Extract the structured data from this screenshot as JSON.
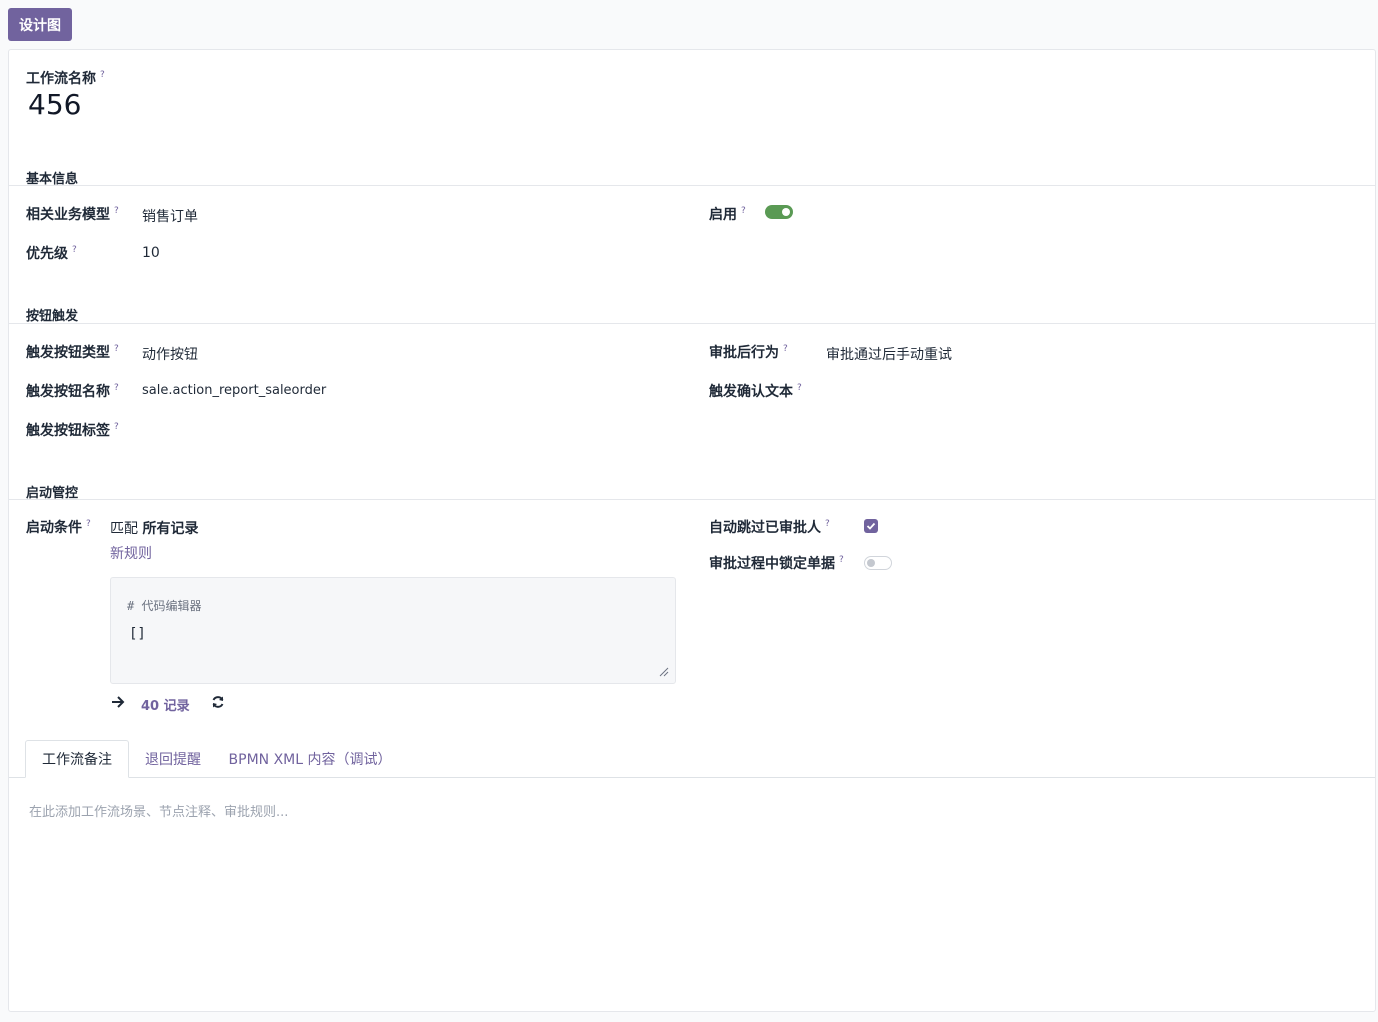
{
  "toolbar": {
    "design_label": "设计图"
  },
  "name_field": {
    "label": "工作流名称",
    "value": "456"
  },
  "help_mark": "?",
  "sections": {
    "basic": {
      "title": "基本信息",
      "model_label": "相关业务模型",
      "model_value": "销售订单",
      "priority_label": "优先级",
      "priority_value": "10",
      "enabled_label": "启用",
      "enabled": true
    },
    "button_trigger": {
      "title": "按钮触发",
      "btn_type_label": "触发按钮类型",
      "btn_type_value": "动作按钮",
      "btn_name_label": "触发按钮名称",
      "btn_name_value": "sale.action_report_saleorder",
      "btn_tag_label": "触发按钮标签",
      "btn_tag_value": "",
      "after_label": "审批后行为",
      "after_value": "审批通过后手动重试",
      "confirm_label": "触发确认文本",
      "confirm_value": ""
    },
    "start_control": {
      "title": "启动管控",
      "condition_label": "启动条件",
      "match_prefix": "匹配",
      "match_value": "所有记录",
      "new_rule": "新规则",
      "code_comment": "# 代码编辑器",
      "code_value": "[]",
      "records_count": "40 记录",
      "skip_label": "自动跳过已审批人",
      "skip_checked": true,
      "lock_label": "审批过程中锁定单据",
      "lock_enabled": false
    }
  },
  "tabs": [
    {
      "label": "工作流备注",
      "active": true
    },
    {
      "label": "退回提醒",
      "active": false
    },
    {
      "label": "BPMN XML 内容（调试）",
      "active": false
    }
  ],
  "notes": {
    "placeholder": "在此添加工作流场景、节点注释、审批规则..."
  },
  "colors": {
    "accent": "#71639e",
    "toggle_on": "#5a9a54"
  }
}
